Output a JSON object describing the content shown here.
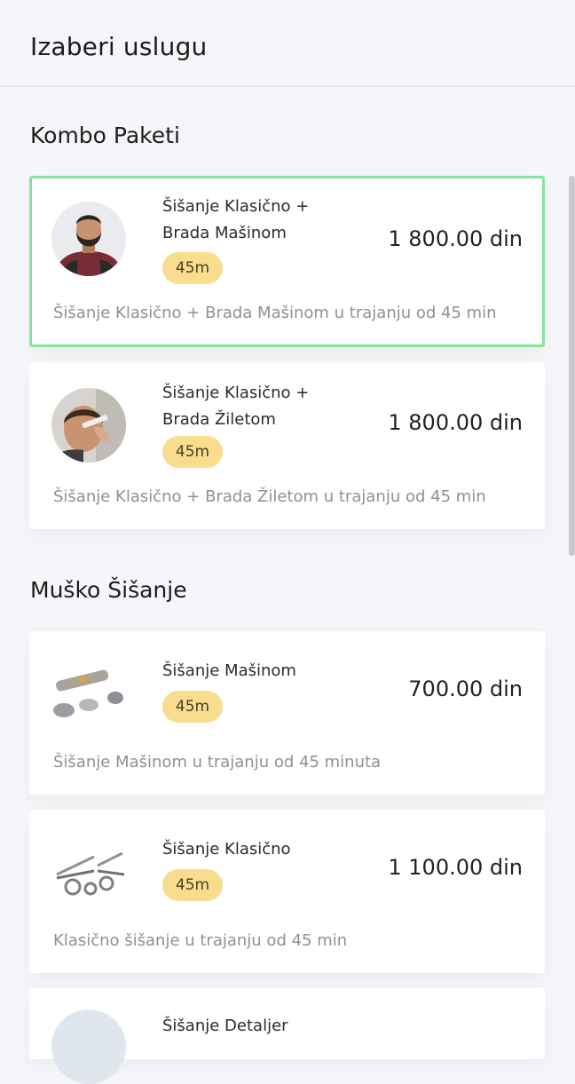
{
  "header": {
    "title": "Izaberi uslugu"
  },
  "sections": [
    {
      "title": "Kombo Paketi",
      "items": [
        {
          "name_line1": "Šišanje Klasično +",
          "name_line2": "Brada Mašinom",
          "duration": "45m",
          "price": "1 800.00 din",
          "description": "Šišanje Klasično + Brada Mašinom u trajanju od 45 min",
          "selected": true,
          "image": "bearded-man-photo"
        },
        {
          "name_line1": "Šišanje Klasično +",
          "name_line2": "Brada Žiletom",
          "duration": "45m",
          "price": "1 800.00 din",
          "description": "Šišanje Klasično + Brada Žiletom u trajanju od 45 min",
          "selected": false,
          "image": "razor-shave-photo"
        }
      ]
    },
    {
      "title": "Muško Šišanje",
      "items": [
        {
          "name_line1": "Šišanje Mašinom",
          "duration": "45m",
          "price": "700.00 din",
          "description": "Šišanje Mašinom u trajanju od 45 minuta",
          "selected": false,
          "image": "hair-clipper-photo"
        },
        {
          "name_line1": "Šišanje Klasično",
          "duration": "45m",
          "price": "1 100.00 din",
          "description": "Klasično šišanje u trajanju od 45 min",
          "selected": false,
          "image": "scissors-photo"
        },
        {
          "name_line1": "Šišanje Detaljer",
          "image": "placeholder-avatar"
        }
      ]
    }
  ],
  "colors": {
    "selected_border": "#86e39e",
    "badge_bg": "#f8dd8e",
    "page_bg": "#f5f6f9"
  }
}
